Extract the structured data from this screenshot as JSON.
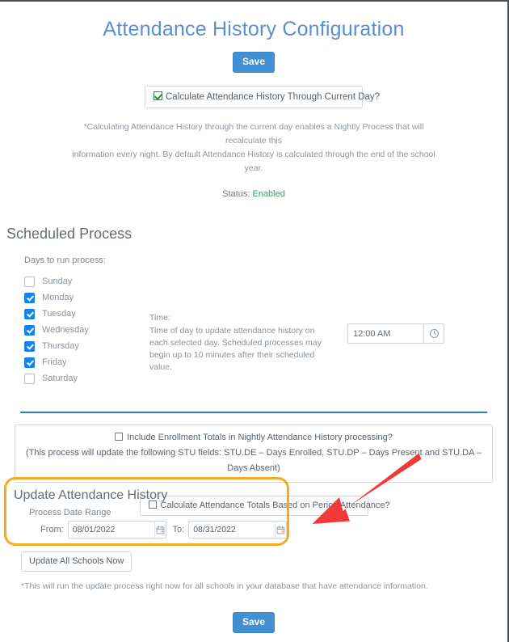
{
  "page": {
    "title": "Attendance History Configuration"
  },
  "toolbar": {
    "save_label": "Save",
    "save_label_bottom": "Save"
  },
  "calculate_current_day": {
    "label": "Calculate Attendance History Through Current Day?",
    "checked": true,
    "checkbox_icon": "green-check-icon"
  },
  "description": {
    "line1": "*Calculating Attendance History through the current day enables a Nightly Process that will recalculate this",
    "line2": "information every night. By default Attendance History is calculated through the end of the school year.",
    "status_label": "Status:",
    "status_value": "Enabled",
    "status_color": "#33a35a"
  },
  "scheduled_process": {
    "heading": "Scheduled Process",
    "days_label": "Days to run process:",
    "days": [
      {
        "label": "Sunday",
        "checked": false
      },
      {
        "label": "Monday",
        "checked": true
      },
      {
        "label": "Tuesday",
        "checked": true
      },
      {
        "label": "Wednesday",
        "checked": true
      },
      {
        "label": "Thursday",
        "checked": true
      },
      {
        "label": "Friday",
        "checked": true
      },
      {
        "label": "Saturday",
        "checked": false
      }
    ],
    "time": {
      "label": "Time:",
      "help_line1": "Time of day to update attendance history on each",
      "help_line2": "selected day. Scheduled processes may begin up to 10",
      "help_line3": "minutes after their scheduled value.",
      "value": "12:00 AM",
      "placeholder": "hh:mm AM",
      "picker_icon": "clock-icon"
    }
  },
  "enrollment": {
    "checkbox_label": "Include Enrollment Totals in Nightly Attendance History processing?",
    "checked": false,
    "note": "(This process will update the following STU fields: STU.DE – Days Enrolled, STU.DP – Days Present and STU.DA – Days Absent)"
  },
  "period_attendance": {
    "checkbox_label": "Calculate Attendance Totals Based on Period Attendance?",
    "checked": false
  },
  "update_attendance_history": {
    "heading": "Update Attendance History",
    "range_label": "Process Date Range",
    "from_label": "From:",
    "from_value": "08/01/2022",
    "from_placeholder": "mm/dd/yyyy",
    "to_label": "To:",
    "to_value": "08/31/2022",
    "to_placeholder": "mm/dd/yyyy",
    "calendar_icon": "calendar-icon",
    "highlight_color": "#f5ab21"
  },
  "update_all": {
    "button_label": "Update All Schools Now",
    "footnote": "*This will run the update process right now for all schools in your database that have attendance information."
  },
  "annotation": {
    "arrow_color": "#f03a3a",
    "arrow_name": "red-arrow-annotation"
  },
  "colors": {
    "title": "#5b8fd0",
    "primary_button": "#4190d3",
    "checkbox_checked": "#1283f5",
    "divider": "#2a7fc9"
  }
}
